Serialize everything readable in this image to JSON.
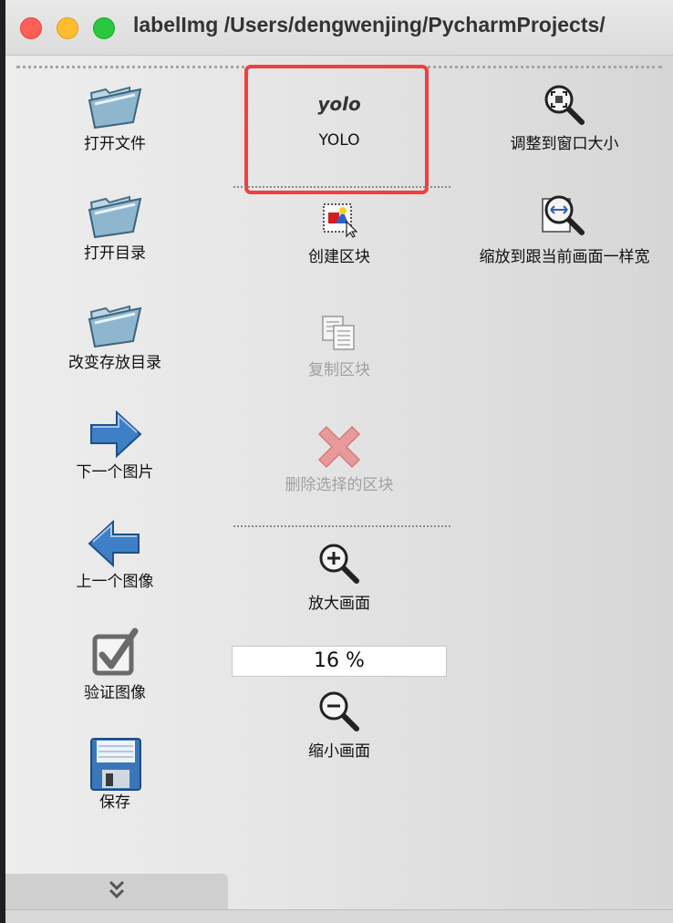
{
  "window": {
    "title": "labelImg /Users/dengwenjing/PycharmProjects/"
  },
  "toolbar": {
    "left_column": [
      {
        "label": "打开文件",
        "icon": "folder-open-icon"
      },
      {
        "label": "打开目录",
        "icon": "folder-open-icon"
      },
      {
        "label": "改变存放目录",
        "icon": "folder-open-icon"
      },
      {
        "label": "下一个图片",
        "icon": "arrow-right-icon"
      },
      {
        "label": "上一个图像",
        "icon": "arrow-left-icon"
      },
      {
        "label": "验证图像",
        "icon": "checkbox-icon"
      },
      {
        "label": "保存",
        "icon": "floppy-disk-icon"
      }
    ],
    "yolo": {
      "icon_text": "yolo",
      "label": "YOLO"
    },
    "create_box": {
      "label": "创建区块",
      "icon": "create-box-icon"
    },
    "duplicate_box": {
      "label": "复制区块",
      "icon": "copy-icon",
      "enabled": false
    },
    "delete_box": {
      "label": "删除选择的区块",
      "icon": "delete-x-icon",
      "enabled": false
    },
    "zoom_in": {
      "label": "放大画面",
      "icon": "zoom-in-icon"
    },
    "zoom_value": "16 %",
    "zoom_out": {
      "label": "缩小画面",
      "icon": "zoom-out-icon"
    },
    "fit_window": {
      "label": "调整到窗口大小",
      "icon": "fit-window-icon"
    },
    "fit_width": {
      "label": "缩放到跟当前画面一样宽",
      "icon": "fit-width-icon"
    },
    "expand_icon": "double-chevron-down-icon"
  },
  "colors": {
    "highlight_border": "#f23e3e",
    "close": "#fe5f57",
    "minimize": "#febc2e",
    "maximize": "#28c840"
  }
}
